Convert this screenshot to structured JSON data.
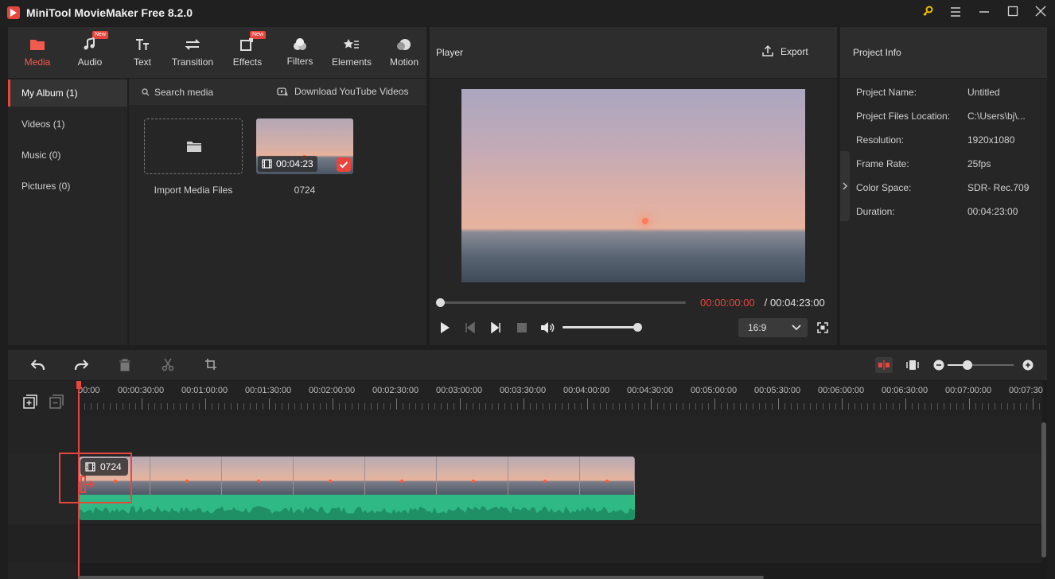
{
  "app": {
    "title": "MiniTool MovieMaker Free 8.2.0"
  },
  "toolbar": {
    "tools": [
      {
        "label": "Media",
        "icon": "folder-icon",
        "new": false,
        "active": true
      },
      {
        "label": "Audio",
        "icon": "music-note-icon",
        "new": true,
        "active": false
      },
      {
        "label": "Text",
        "icon": "text-icon",
        "new": false,
        "active": false
      },
      {
        "label": "Transition",
        "icon": "transition-arrows-icon",
        "new": false,
        "active": false
      },
      {
        "label": "Effects",
        "icon": "effects-icon",
        "new": true,
        "active": false
      },
      {
        "label": "Filters",
        "icon": "filters-icon",
        "new": false,
        "active": false
      },
      {
        "label": "Elements",
        "icon": "elements-icon",
        "new": false,
        "active": false
      },
      {
        "label": "Motion",
        "icon": "motion-icon",
        "new": false,
        "active": false
      }
    ],
    "new_badge": "New"
  },
  "album": {
    "items": [
      {
        "label": "My Album (1)",
        "active": true
      },
      {
        "label": "Videos (1)",
        "active": false
      },
      {
        "label": "Music (0)",
        "active": false
      },
      {
        "label": "Pictures (0)",
        "active": false
      }
    ]
  },
  "media": {
    "search_label": "Search media",
    "download_label": "Download YouTube Videos",
    "import_label": "Import Media Files",
    "clip_duration": "00:04:23",
    "clip_name": "0724"
  },
  "player": {
    "title": "Player",
    "export_label": "Export",
    "current_time": "00:00:00:00",
    "separator": " / ",
    "total_time": "00:04:23:00",
    "aspect": "16:9",
    "progress_fraction": 0.0,
    "volume_fraction": 1.0
  },
  "project_info": {
    "title": "Project Info",
    "rows": [
      {
        "key": "Project Name:",
        "value": "Untitled"
      },
      {
        "key": "Project Files Location:",
        "value": "C:\\Users\\bj\\..."
      },
      {
        "key": "Resolution:",
        "value": "1920x1080"
      },
      {
        "key": "Frame Rate:",
        "value": "25fps"
      },
      {
        "key": "Color Space:",
        "value": "SDR- Rec.709"
      },
      {
        "key": "Duration:",
        "value": "00:04:23:00"
      }
    ]
  },
  "timeline": {
    "ticks": [
      "00:00",
      "00:00:30:00",
      "00:01:00:00",
      "00:01:30:00",
      "00:02:00:00",
      "00:02:30:00",
      "00:03:00:00",
      "00:03:30:00",
      "00:04:00:00",
      "00:04:30:00",
      "00:05:00:00",
      "00:05:30:00",
      "00:06:00:00",
      "00:06:30:00",
      "00:07:00:00",
      "00:07:30"
    ],
    "clip_label": "0724",
    "zoom_fraction": 0.3
  },
  "colors": {
    "accent": "#e8453c",
    "audio_wave": "#2fb985"
  }
}
